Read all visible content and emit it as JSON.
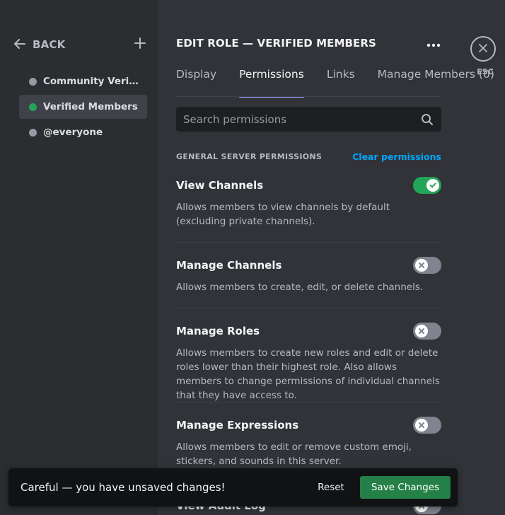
{
  "sidebar": {
    "back_label": "BACK",
    "roles": [
      {
        "name": "Community Verificat...",
        "color": "#949ba4",
        "active": false
      },
      {
        "name": "Verified Members",
        "color": "#23a559",
        "active": true
      },
      {
        "name": "@everyone",
        "color": "#949ba4",
        "active": false
      }
    ]
  },
  "header": {
    "title": "EDIT ROLE — VERIFIED MEMBERS"
  },
  "tabs": [
    {
      "label": "Display",
      "active": false
    },
    {
      "label": "Permissions",
      "active": true
    },
    {
      "label": "Links",
      "active": false
    },
    {
      "label": "Manage Members (0)",
      "active": false
    }
  ],
  "search": {
    "placeholder": "Search permissions"
  },
  "section": {
    "title": "GENERAL SERVER PERMISSIONS",
    "clear_label": "Clear permissions"
  },
  "permissions": [
    {
      "name": "View Channels",
      "desc": "Allows members to view channels by default (excluding private channels).",
      "enabled": true
    },
    {
      "name": "Manage Channels",
      "desc": "Allows members to create, edit, or delete channels.",
      "enabled": false
    },
    {
      "name": "Manage Roles",
      "desc": "Allows members to create new roles and edit or delete roles lower than their highest role. Also allows members to change permissions of individual channels that they have access to.",
      "enabled": false
    },
    {
      "name": "Manage Expressions",
      "desc": "Allows members to edit or remove custom emoji, stickers, and sounds in this server.",
      "enabled": false
    },
    {
      "name": "View Audit Log",
      "desc": "",
      "enabled": false
    }
  ],
  "close": {
    "esc_label": "ESC"
  },
  "unsaved_bar": {
    "message": "Careful — you have unsaved changes!",
    "reset_label": "Reset",
    "save_label": "Save Changes"
  },
  "colors": {
    "accent": "#949cf7",
    "toggle_on": "#23a559",
    "toggle_off": "#80848e",
    "link": "#00a8fc",
    "save": "#248046"
  }
}
